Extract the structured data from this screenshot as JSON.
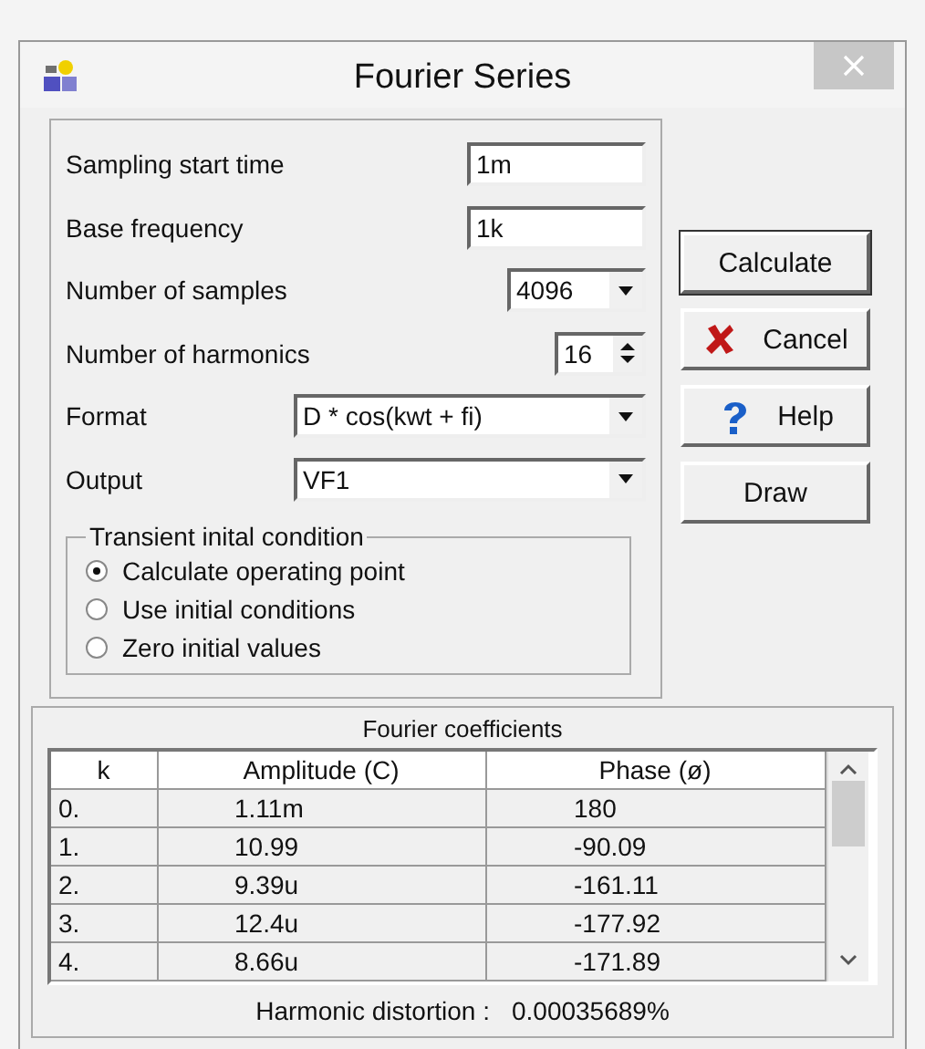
{
  "window": {
    "title": "Fourier Series"
  },
  "parameters": [
    {
      "kind": "text",
      "label": "Sampling start time",
      "value": "1m"
    },
    {
      "kind": "text",
      "label": "Base frequency",
      "value": "1k"
    },
    {
      "kind": "dropdown",
      "label": "Number of samples",
      "value": "4096"
    },
    {
      "kind": "spinner",
      "label": "Number of harmonics",
      "value": "16"
    },
    {
      "kind": "dropdown",
      "label": "Format",
      "value": "D * cos(kwt + fi)"
    },
    {
      "kind": "dropdown",
      "label": "Output",
      "value": "VF1"
    }
  ],
  "initial_condition": {
    "title": "Transient inital condition",
    "options": [
      {
        "label": "Calculate operating point",
        "selected": true
      },
      {
        "label": "Use initial conditions",
        "selected": false
      },
      {
        "label": "Zero initial values",
        "selected": false
      }
    ]
  },
  "buttons": [
    {
      "kind": "calculate",
      "label": "Calculate"
    },
    {
      "kind": "cancel",
      "label": "Cancel"
    },
    {
      "kind": "help",
      "label": "Help"
    },
    {
      "kind": "draw",
      "label": "Draw"
    }
  ],
  "coefficients": {
    "title": "Fourier coefficients",
    "columns": [
      "k",
      "Amplitude (C)",
      "Phase (ø)"
    ],
    "rows": [
      [
        "0.",
        "1.11m",
        "180"
      ],
      [
        "1.",
        "10.99",
        "-90.09"
      ],
      [
        "2.",
        "9.39u",
        "-161.11"
      ],
      [
        "3.",
        "12.4u",
        "-177.92"
      ],
      [
        "4.",
        "8.66u",
        "-171.89"
      ]
    ],
    "distortion_label": "Harmonic distortion :",
    "distortion_value": "0.00035689%"
  }
}
